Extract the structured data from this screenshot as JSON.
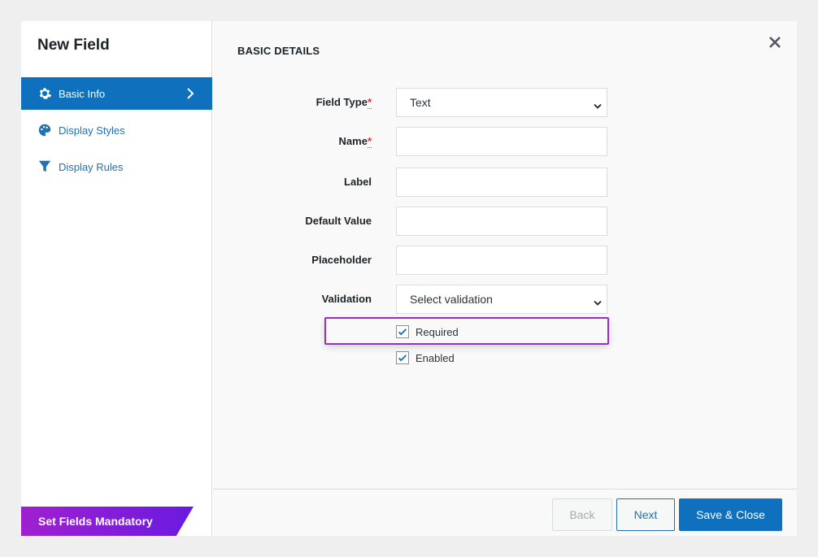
{
  "sidebar": {
    "title": "New Field",
    "items": [
      {
        "label": "Basic Info",
        "icon": "gear-icon",
        "active": true
      },
      {
        "label": "Display Styles",
        "icon": "palette-icon",
        "active": false
      },
      {
        "label": "Display Rules",
        "icon": "filter-icon",
        "active": false
      }
    ],
    "promo": "Set Fields Mandatory"
  },
  "main": {
    "section_title": "BASIC DETAILS",
    "fields": {
      "field_type": {
        "label": "Field Type",
        "required_mark": "*",
        "value": "Text"
      },
      "name": {
        "label": "Name",
        "required_mark": "*",
        "value": ""
      },
      "label": {
        "label": "Label",
        "value": ""
      },
      "default_value": {
        "label": "Default Value",
        "value": ""
      },
      "placeholder": {
        "label": "Placeholder",
        "value": ""
      },
      "validation": {
        "label": "Validation",
        "value": "Select validation"
      }
    },
    "checkboxes": {
      "required": {
        "label": "Required",
        "checked": true
      },
      "enabled": {
        "label": "Enabled",
        "checked": true
      }
    }
  },
  "footer": {
    "back_label": "Back",
    "next_label": "Next",
    "save_label": "Save & Close"
  },
  "colors": {
    "accent": "#0f71bd",
    "link": "#2271b1",
    "highlight": "#9b2cc7",
    "required": "#d63638"
  }
}
